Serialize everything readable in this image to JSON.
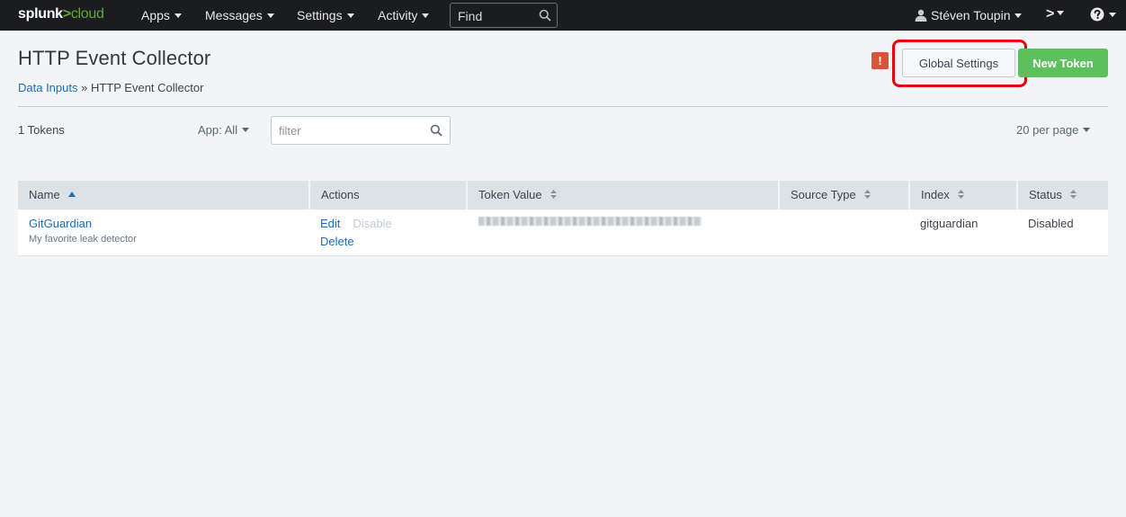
{
  "topbar": {
    "logo_main": "splunk",
    "logo_sep": ">",
    "logo_sub": "cloud",
    "nav": [
      "Apps",
      "Messages",
      "Settings",
      "Activity"
    ],
    "find_placeholder": "Find",
    "user": "Stéven Toupin",
    "prompt_label": ">"
  },
  "header": {
    "title": "HTTP Event Collector",
    "breadcrumb_link": "Data Inputs",
    "breadcrumb_sep": " » ",
    "breadcrumb_current": "HTTP Event Collector",
    "alert_badge": "!",
    "global_settings": "Global Settings",
    "new_token": "New Token"
  },
  "controls": {
    "token_count": "1 Tokens",
    "app_filter": "App: All",
    "filter_placeholder": "filter",
    "per_page": "20 per page"
  },
  "table": {
    "columns": [
      "Name",
      "Actions",
      "Token Value",
      "Source Type",
      "Index",
      "Status"
    ],
    "rows": [
      {
        "name": "GitGuardian",
        "description": "My favorite leak detector",
        "action_edit": "Edit",
        "action_disable": "Disable",
        "action_delete": "Delete",
        "source_type": "",
        "index": "gitguardian",
        "status": "Disabled"
      }
    ]
  },
  "colors": {
    "accent_link": "#1e6bb8",
    "new_token_green": "#5cc05c",
    "alert_red": "#d6563c",
    "highlight_red": "#e8000b",
    "topbar_bg": "#1a1c20"
  }
}
